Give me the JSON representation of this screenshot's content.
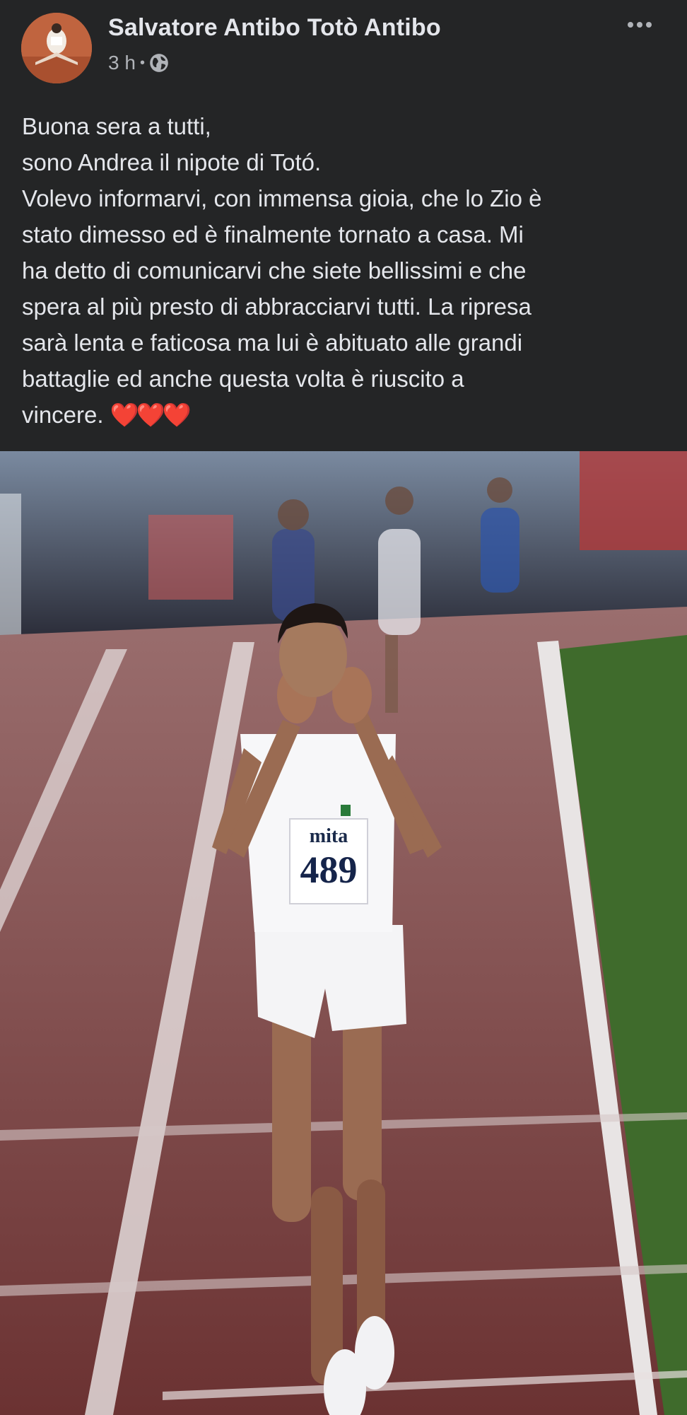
{
  "post": {
    "author": "Salvatore Antibo Totò Antibo",
    "time": "3 h",
    "separator": "•",
    "privacy_icon": "globe-icon",
    "more_icon": "more-horizontal-icon",
    "text_lines": [
      "Buona sera a tutti,",
      "sono Andrea il nipote di Totó.",
      "Volevo informarvi, con immensa gioia, che lo Zio è",
      "stato dimesso ed è finalmente tornato a casa. Mi",
      "ha detto di comunicarvi che siete bellissimi e che",
      "spera al più presto di abbracciarvi tutti. La ripresa",
      "sarà lenta e faticosa ma lui è abituato alle grandi",
      "battaglie ed anche questa volta è riuscito a",
      "vincere."
    ],
    "hearts": "❤️❤️❤️",
    "photo": {
      "bib_sponsor": "mita",
      "bib_number": "489"
    }
  },
  "colors": {
    "background": "#242526",
    "text": "#e4e6eb",
    "secondary_text": "#b0b3b8",
    "track": "#7a3b3b",
    "grass": "#3f6b2c"
  }
}
